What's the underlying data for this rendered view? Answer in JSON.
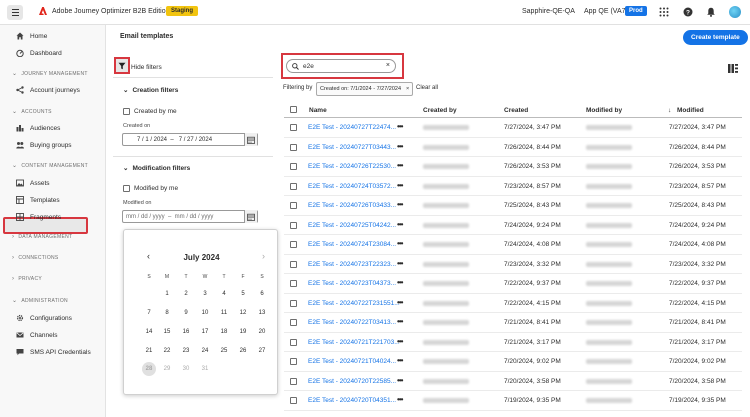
{
  "app": {
    "title": "Adobe Journey Optimizer B2B Edition",
    "env_badge": "Staging",
    "org": "Sapphire-QE-QA",
    "sandbox": "App QE (VA7)",
    "sandbox_badge": "Prod"
  },
  "sidebar": {
    "items": [
      {
        "label": "Home",
        "icon": "home-icon"
      },
      {
        "label": "Dashboard",
        "icon": "dashboard-icon"
      },
      {
        "label": "Account journeys",
        "icon": "journey-icon"
      },
      {
        "label": "Audiences",
        "icon": "audiences-icon"
      },
      {
        "label": "Buying groups",
        "icon": "buying-groups-icon"
      },
      {
        "label": "Assets",
        "icon": "assets-icon"
      },
      {
        "label": "Templates",
        "icon": "templates-icon"
      },
      {
        "label": "Fragments",
        "icon": "fragments-icon"
      },
      {
        "label": "Configurations",
        "icon": "configurations-icon"
      },
      {
        "label": "Channels",
        "icon": "channels-icon"
      },
      {
        "label": "SMS API Credentials",
        "icon": "sms-icon"
      }
    ],
    "sections": [
      "JOURNEY MANAGEMENT",
      "ACCOUNTS",
      "CONTENT MANAGEMENT",
      "DATA MANAGEMENT",
      "CONNECTIONS",
      "PRIVACY",
      "ADMINISTRATION"
    ]
  },
  "page": {
    "title": "Email templates",
    "create_button": "Create template",
    "hide_filters": "Hide filters"
  },
  "filters": {
    "creation_header": "Creation filters",
    "created_by_me": "Created by me",
    "created_on_label": "Created on",
    "created_on_value": "7 / 1 / 2024  –   7 / 27 / 2024",
    "modification_header": "Modification filters",
    "modified_by_me": "Modified by me",
    "modified_on_label": "Modified on",
    "modified_on_placeholder": "mm / dd / yyyy  –  mm / dd / yyyy"
  },
  "calendar": {
    "month_label": "July 2024",
    "weekdays": [
      "S",
      "M",
      "T",
      "W",
      "T",
      "F",
      "S"
    ],
    "weeks": [
      [
        "",
        "1",
        "2",
        "3",
        "4",
        "5",
        "6"
      ],
      [
        "7",
        "8",
        "9",
        "10",
        "11",
        "12",
        "13"
      ],
      [
        "14",
        "15",
        "16",
        "17",
        "18",
        "19",
        "20"
      ],
      [
        "21",
        "22",
        "23",
        "24",
        "25",
        "26",
        "27"
      ],
      [
        "28",
        "29",
        "30",
        "31",
        "",
        "",
        ""
      ]
    ],
    "today": "28"
  },
  "search": {
    "value": "e2e"
  },
  "filtering": {
    "label": "Filtering by",
    "chip": "Created on: 7/1/2024 - 7/27/2024",
    "clear_all": "Clear all"
  },
  "table": {
    "columns": [
      "Name",
      "Created by",
      "Created",
      "Modified by",
      "Modified"
    ],
    "sort_indicator": "↓",
    "more_glyph": "•••",
    "rows": [
      {
        "name": "E2E Test - 20240727T22474...",
        "created": "7/27/2024, 3:47 PM",
        "modified": "7/27/2024, 3:47 PM"
      },
      {
        "name": "E2E Test - 20240727T03443...",
        "created": "7/26/2024, 8:44 PM",
        "modified": "7/26/2024, 8:44 PM"
      },
      {
        "name": "E2E Test - 20240726T22530...",
        "created": "7/26/2024, 3:53 PM",
        "modified": "7/26/2024, 3:53 PM"
      },
      {
        "name": "E2E Test - 20240724T03572...",
        "created": "7/23/2024, 8:57 PM",
        "modified": "7/23/2024, 8:57 PM"
      },
      {
        "name": "E2E Test - 20240726T03433...",
        "created": "7/25/2024, 8:43 PM",
        "modified": "7/25/2024, 8:43 PM"
      },
      {
        "name": "E2E Test - 20240725T04242...",
        "created": "7/24/2024, 9:24 PM",
        "modified": "7/24/2024, 9:24 PM"
      },
      {
        "name": "E2E Test - 20240724T23084...",
        "created": "7/24/2024, 4:08 PM",
        "modified": "7/24/2024, 4:08 PM"
      },
      {
        "name": "E2E Test - 20240723T22323...",
        "created": "7/23/2024, 3:32 PM",
        "modified": "7/23/2024, 3:32 PM"
      },
      {
        "name": "E2E Test - 20240723T04373...",
        "created": "7/22/2024, 9:37 PM",
        "modified": "7/22/2024, 9:37 PM"
      },
      {
        "name": "E2E Test - 20240722T231551...",
        "created": "7/22/2024, 4:15 PM",
        "modified": "7/22/2024, 4:15 PM"
      },
      {
        "name": "E2E Test - 20240722T03413...",
        "created": "7/21/2024, 8:41 PM",
        "modified": "7/21/2024, 8:41 PM"
      },
      {
        "name": "E2E Test - 20240721T221703...",
        "created": "7/21/2024, 3:17 PM",
        "modified": "7/21/2024, 3:17 PM"
      },
      {
        "name": "E2E Test - 20240721T04024...",
        "created": "7/20/2024, 9:02 PM",
        "modified": "7/20/2024, 9:02 PM"
      },
      {
        "name": "E2E Test - 20240720T22585...",
        "created": "7/20/2024, 3:58 PM",
        "modified": "7/20/2024, 3:58 PM"
      },
      {
        "name": "E2E Test - 20240720T04351...",
        "created": "7/19/2024, 9:35 PM",
        "modified": "7/19/2024, 9:35 PM"
      }
    ]
  },
  "colors": {
    "accent": "#1473e6",
    "highlight": "#d7373f",
    "staging": "#f2c40f"
  }
}
